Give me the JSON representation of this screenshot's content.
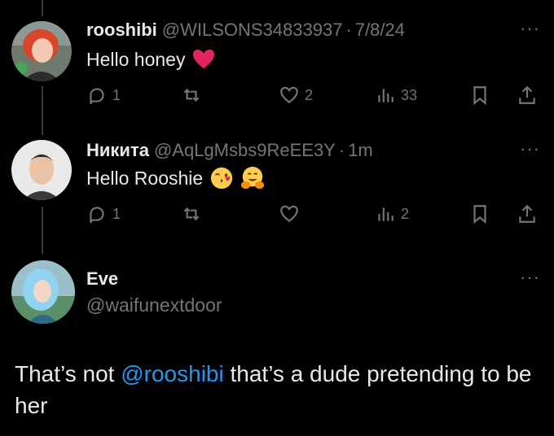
{
  "tweets": [
    {
      "name": "rooshibi",
      "handle": "@WILSONS34833937",
      "separator": "·",
      "time": "7/8/24",
      "text": "Hello honey",
      "replies": "1",
      "likes": "2",
      "views": "33"
    },
    {
      "name": "Никита",
      "handle": "@AqLgMsbs9ReEE3Y",
      "separator": "·",
      "time": "1m",
      "text": "Hello Rooshie",
      "replies": "1",
      "views": "2"
    }
  ],
  "reply": {
    "name": "Eve",
    "handle": "@waifunextdoor",
    "text_before": "That’s not ",
    "mention": "@rooshibi",
    "text_after": " that’s a dude pretending to be her"
  },
  "more_glyph": "···",
  "colors": {
    "background": "#000000",
    "text": "#e7e9ea",
    "muted": "#71767b",
    "link": "#1d9bf0",
    "heart": "#e0245e"
  },
  "icons": [
    "reply-icon",
    "retweet-icon",
    "like-icon",
    "views-icon",
    "bookmark-icon",
    "share-icon",
    "red-heart-emoji",
    "kiss-emoji",
    "hug-emoji"
  ]
}
